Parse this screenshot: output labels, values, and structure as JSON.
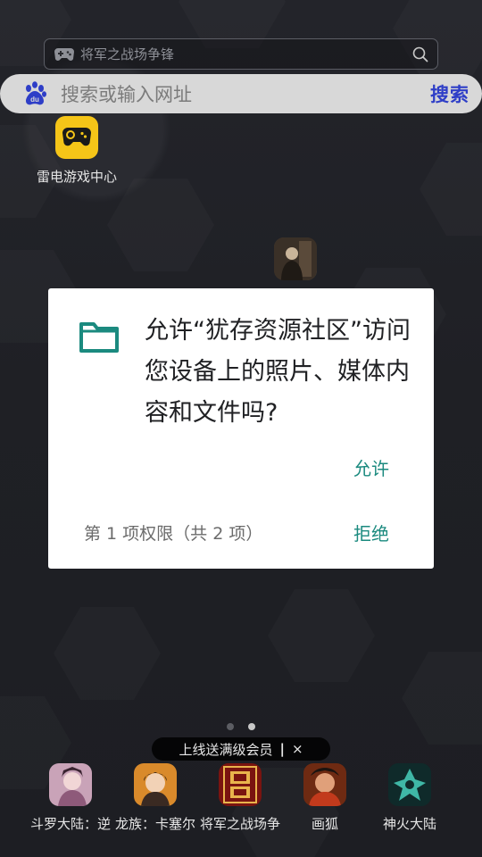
{
  "game_search": {
    "placeholder_text": "将军之战场争锋"
  },
  "baidu_bar": {
    "placeholder": "搜索或输入网址",
    "button": "搜索"
  },
  "apps": [
    {
      "label": "雷电游戏中心",
      "icon": "gamepad-icon"
    }
  ],
  "dialog": {
    "message": "允许“犹存资源社区”访问您设备上的照片、媒体内容和文件吗?",
    "allow": "允许",
    "counter": "第 1 项权限（共 2 项）",
    "deny": "拒绝",
    "accent_color": "#1b8a7f"
  },
  "pager": {
    "pages": 2,
    "active": 2
  },
  "promo": {
    "text": "上线送满级会员",
    "separator": "|",
    "close": "×"
  },
  "dock": [
    {
      "label": "斗罗大陆：逆"
    },
    {
      "label": "龙族：卡塞尔"
    },
    {
      "label": "将军之战场争"
    },
    {
      "label": "画狐"
    },
    {
      "label": "神火大陆"
    }
  ]
}
